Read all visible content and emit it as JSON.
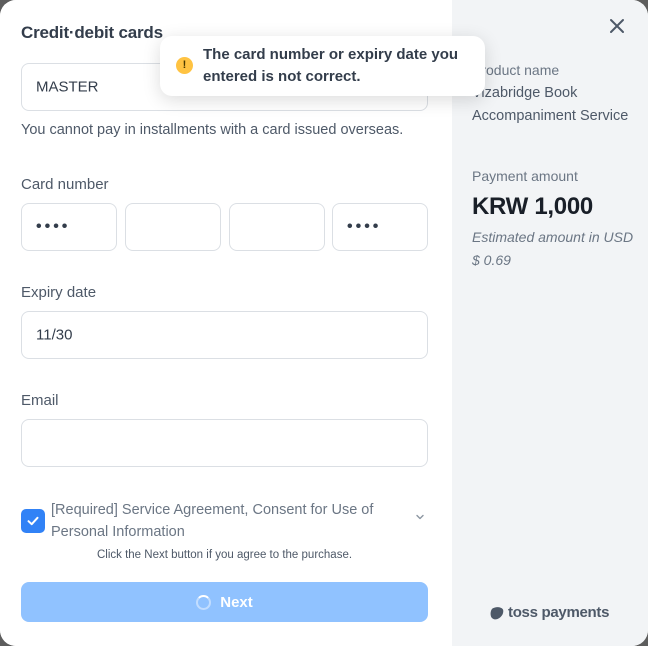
{
  "modal": {
    "title": "Credit·debit cards",
    "card_type_value": "MASTER",
    "overseas_note": "You cannot pay in installments with a card issued overseas.",
    "card_number": {
      "label": "Card number",
      "segments": [
        "••••",
        "",
        "",
        "••••"
      ]
    },
    "expiry": {
      "label": "Expiry date",
      "value": "11/30"
    },
    "email": {
      "label": "Email",
      "value": ""
    },
    "consent": {
      "checked": true,
      "text": "[Required] Service Agreement, Consent for Use of Personal Information"
    },
    "hint": "Click the Next button if you agree to the purchase.",
    "next_label": "Next"
  },
  "toast": {
    "message": "The card number or expiry date you entered is not correct.",
    "icon": "exclamation-icon"
  },
  "summary": {
    "product_label": "Product name",
    "product_name": "Vizabridge Book Accompaniment Service",
    "payment_label": "Payment amount",
    "amount": "KRW 1,000",
    "estimate": "Estimated amount in USD $ 0.69",
    "brand": "toss payments"
  },
  "colors": {
    "primary": "#3182f6",
    "button_disabled": "#90c2ff",
    "warning": "#ffc342",
    "summary_bg": "#f2f4f6"
  }
}
